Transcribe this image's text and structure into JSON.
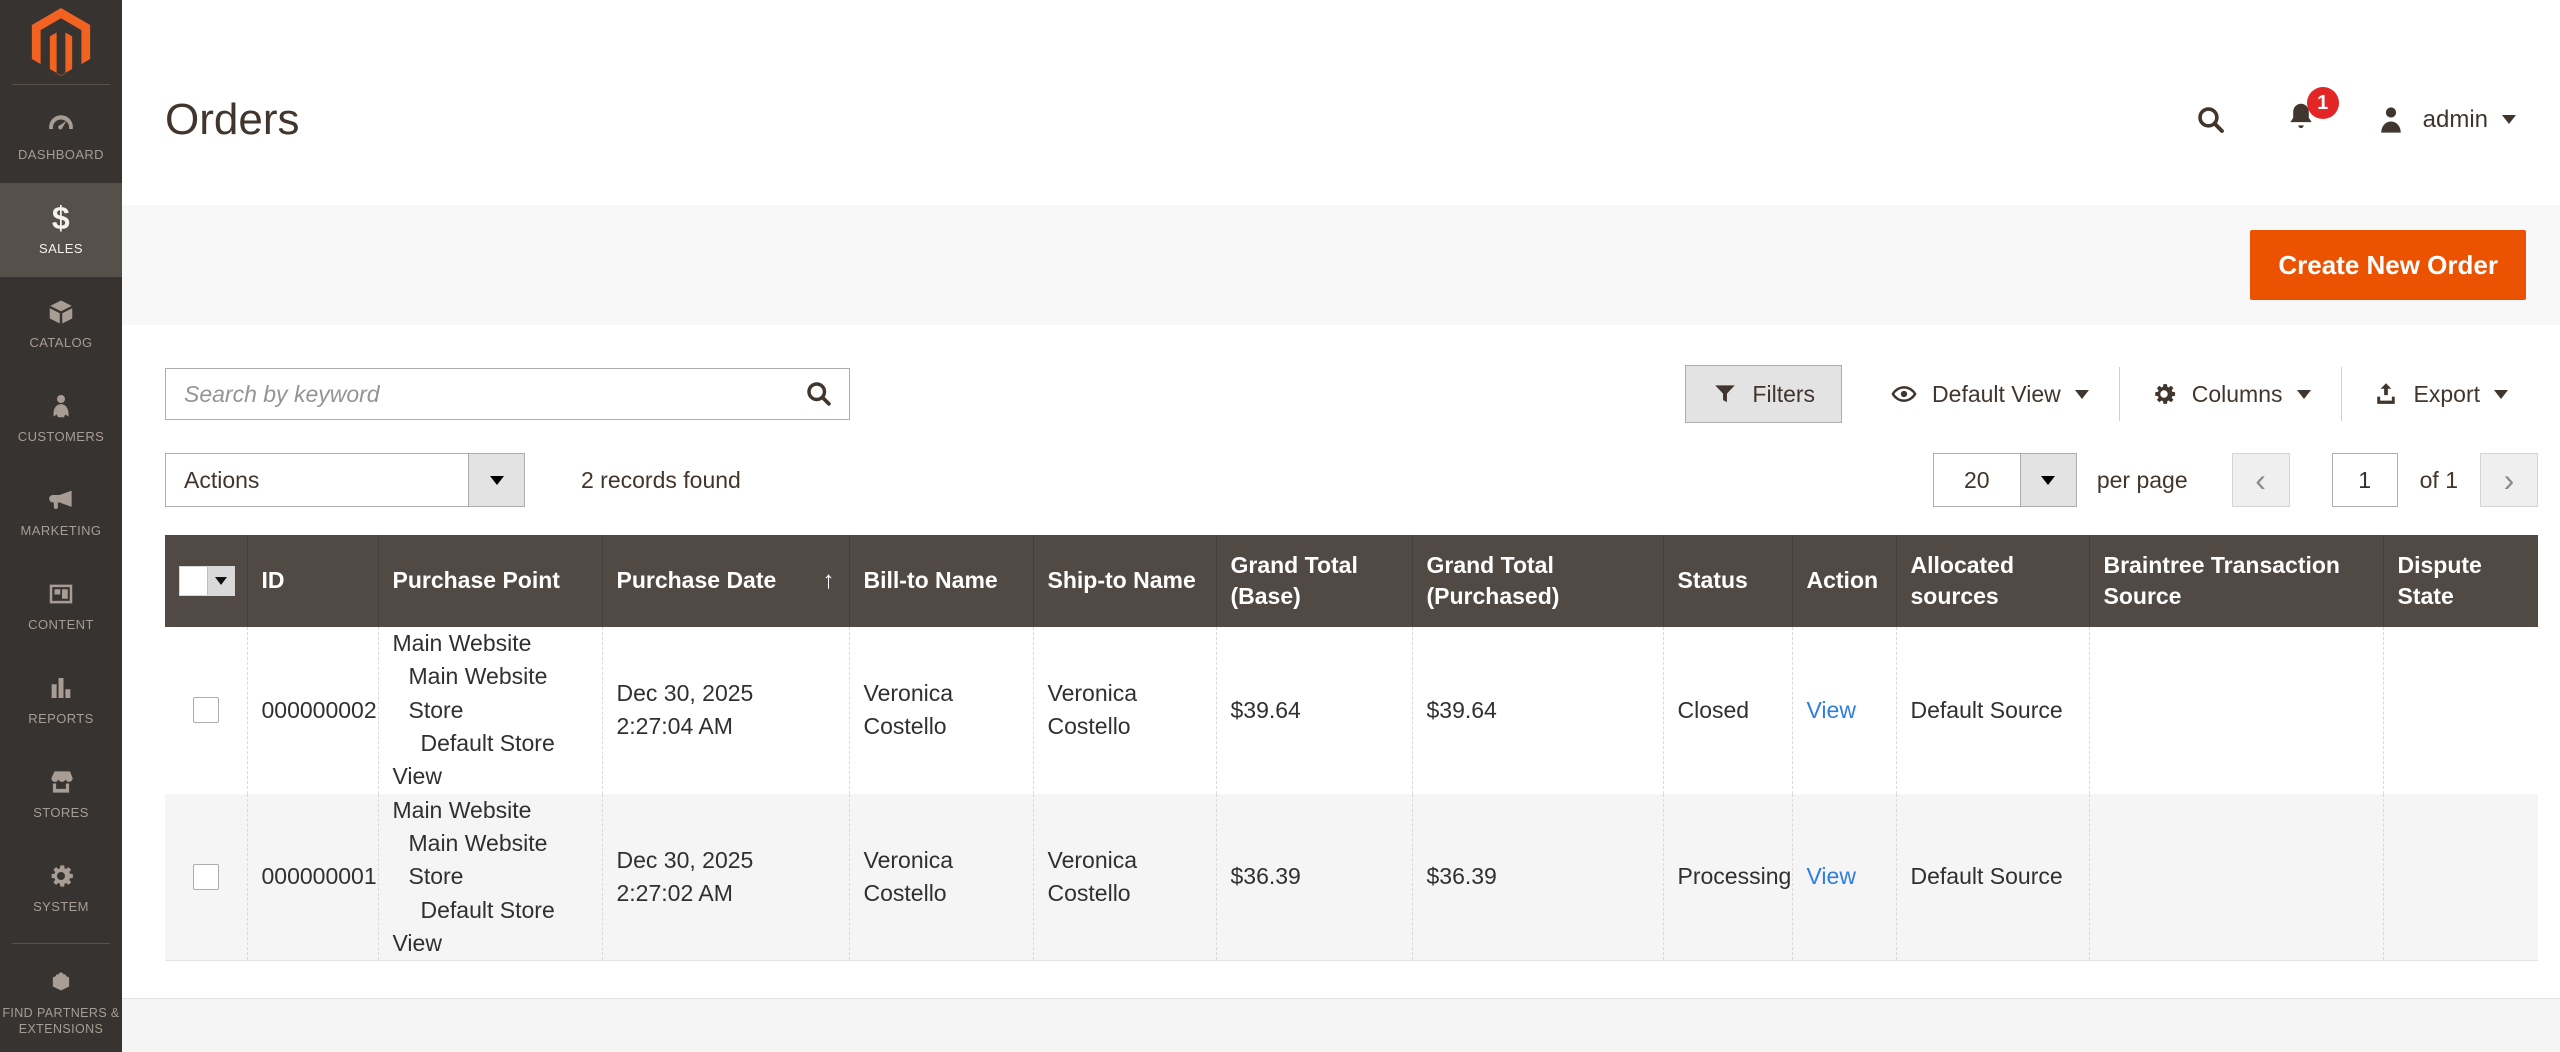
{
  "colors": {
    "accent_orange": "#eb5202",
    "logo_orange": "#f26322",
    "sidebar_bg": "#373330",
    "table_header_bg": "#514943",
    "badge_red": "#e22626",
    "link_blue": "#2e7de0"
  },
  "sidebar": {
    "items": [
      {
        "label": "DASHBOARD"
      },
      {
        "label": "SALES",
        "glyph": "$",
        "active": true
      },
      {
        "label": "CATALOG"
      },
      {
        "label": "CUSTOMERS"
      },
      {
        "label": "MARKETING"
      },
      {
        "label": "CONTENT"
      },
      {
        "label": "REPORTS"
      },
      {
        "label": "STORES"
      },
      {
        "label": "SYSTEM"
      },
      {
        "label": "FIND PARTNERS & EXTENSIONS"
      }
    ]
  },
  "header": {
    "title": "Orders",
    "notification_count": "1",
    "username": "admin"
  },
  "page_actions": {
    "create_order_label": "Create New Order"
  },
  "grid_controls": {
    "search_placeholder": "Search by keyword",
    "filters_label": "Filters",
    "view_label": "Default View",
    "columns_label": "Columns",
    "export_label": "Export"
  },
  "actions_bar": {
    "actions_label": "Actions",
    "records_found": "2 records found",
    "per_page_value": "20",
    "per_page_label": "per page",
    "prev_icon": "‹",
    "next_icon": "›",
    "current_page": "1",
    "of_label": "of 1"
  },
  "table": {
    "columns": [
      "ID",
      "Purchase Point",
      "Purchase Date",
      "Bill-to Name",
      "Ship-to Name",
      "Grand Total (Base)",
      "Grand Total (Purchased)",
      "Status",
      "Action",
      "Allocated sources",
      "Braintree Transaction Source",
      "Dispute State"
    ],
    "sort_arrow": "↑",
    "rows": [
      {
        "id": "000000002",
        "purchase_point": [
          "Main Website",
          "Main Website Store",
          "Default Store",
          "View"
        ],
        "purchase_date": "Dec 30, 2025 2:27:04 AM",
        "bill_to_name": "Veronica Costello",
        "ship_to_name": "Veronica Costello",
        "grand_total_base": "$39.64",
        "grand_total_purchased": "$39.64",
        "status": "Closed",
        "action": "View",
        "allocated_sources": "Default Source",
        "braintree_transaction_source": "",
        "dispute_state": ""
      },
      {
        "id": "000000001",
        "purchase_point": [
          "Main Website",
          "Main Website Store",
          "Default Store",
          "View"
        ],
        "purchase_date": "Dec 30, 2025 2:27:02 AM",
        "bill_to_name": "Veronica Costello",
        "ship_to_name": "Veronica Costello",
        "grand_total_base": "$36.39",
        "grand_total_purchased": "$36.39",
        "status": "Processing",
        "action": "View",
        "allocated_sources": "Default Source",
        "braintree_transaction_source": "",
        "dispute_state": ""
      }
    ]
  }
}
